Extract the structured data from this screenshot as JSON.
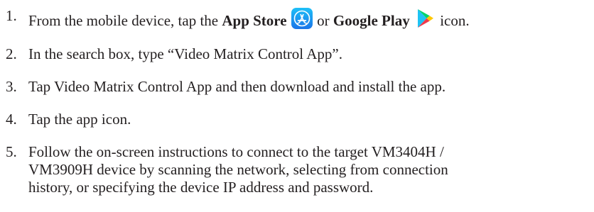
{
  "steps": [
    {
      "number": "1.",
      "text_before": "From the mobile device, tap the ",
      "app_store_label": "App Store",
      "app_store_icon": "app-store-icon",
      "connector": " or ",
      "google_play_label": "Google Play",
      "google_play_icon": "google-play-icon",
      "text_after": " icon."
    },
    {
      "number": "2.",
      "text": "In the search box, type “Video Matrix Control App”."
    },
    {
      "number": "3.",
      "text": "Tap Video Matrix Control App and then download and install the app."
    },
    {
      "number": "4.",
      "text": "Tap the app icon."
    },
    {
      "number": "5.",
      "lines": [
        "Follow the on-screen instructions to connect to the target VM3404H /",
        "VM3909H device by scanning the network, selecting from connection",
        "history, or specifying the device IP address and password."
      ]
    }
  ],
  "colors": {
    "text": "#231f20",
    "app_store_blue": "#1a9df4",
    "play_green": "#00d26a",
    "play_blue": "#1ec3f4",
    "play_red": "#f0384a",
    "play_yellow": "#ffc800"
  }
}
